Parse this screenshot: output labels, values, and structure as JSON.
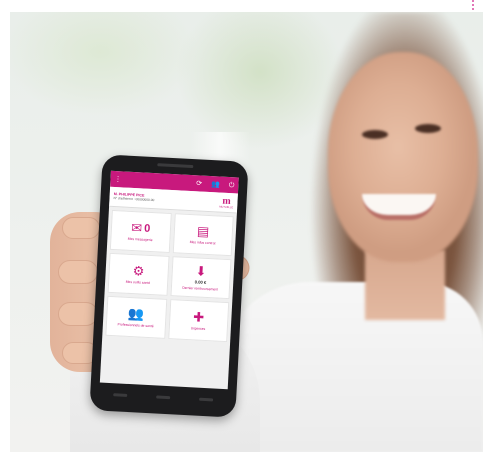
{
  "app": {
    "icons": [
      "menu-icon",
      "refresh-icon",
      "users-icon",
      "power-icon"
    ],
    "user": {
      "name": "M. PHILIPPE PICE",
      "id_line": "N° d'adhérent : 00000000-00"
    },
    "logo": {
      "letter": "m",
      "text": "MUTUELLE"
    },
    "tiles": [
      {
        "icon": "mail-icon",
        "count": "0",
        "label": "Mes messagerie"
      },
      {
        "icon": "document-icon",
        "label": "Mes infos contrat"
      },
      {
        "icon": "gears-icon",
        "label": "Mes outils santé"
      },
      {
        "icon": "download-icon",
        "amount": "0.00 €",
        "label": "Dernier remboursement"
      },
      {
        "icon": "people-icon",
        "label": "Professionnels de santé"
      },
      {
        "icon": "first-aid-icon",
        "label": "Urgences"
      }
    ]
  },
  "colors": {
    "brand": "#c8197d",
    "phone": "#1c1c1e",
    "screen_bg": "#f0f0f0"
  }
}
